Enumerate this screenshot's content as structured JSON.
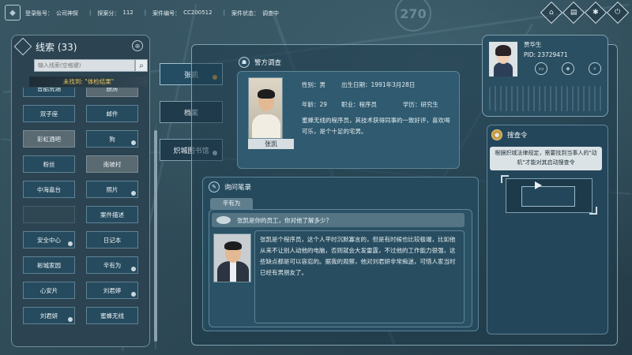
{
  "topbar": {
    "items": [
      {
        "label": "登录账号：",
        "value": "公司神探"
      },
      {
        "label": "探案分：",
        "value": "112"
      },
      {
        "label": "案件编号：",
        "value": "CC200512"
      },
      {
        "label": "案件状态：",
        "value": "调查中"
      }
    ],
    "icons": [
      "home-icon",
      "document-icon",
      "settings-icon",
      "power-icon"
    ]
  },
  "map": {
    "number": "270"
  },
  "clues": {
    "title": "线索 (33)",
    "search_placeholder": "输入线索(空格键)",
    "not_found": "未找到: \"体检结果\"",
    "items": [
      {
        "label": "曾酷荒涵",
        "style": "normal"
      },
      {
        "label": "厨房",
        "style": "gray"
      },
      {
        "label": "双子座",
        "style": "normal"
      },
      {
        "label": "邮件",
        "style": "normal"
      },
      {
        "label": "彩虹酒吧",
        "style": "gray"
      },
      {
        "label": "狗",
        "style": "normal",
        "mark": true
      },
      {
        "label": "粉丝",
        "style": "normal"
      },
      {
        "label": "南坡村",
        "style": "gray"
      },
      {
        "label": "中海嘉台",
        "style": "normal"
      },
      {
        "label": "照片",
        "style": "normal",
        "mark": true
      },
      {
        "label": "",
        "style": "empty"
      },
      {
        "label": "案件描述",
        "style": "normal"
      },
      {
        "label": "安全中心",
        "style": "normal",
        "mark": true
      },
      {
        "label": "日记本",
        "style": "normal"
      },
      {
        "label": "彬城家园",
        "style": "normal"
      },
      {
        "label": "辛有为",
        "style": "normal",
        "mark": true
      },
      {
        "label": "心安片",
        "style": "normal"
      },
      {
        "label": "刘君婷",
        "style": "normal",
        "mark": true
      },
      {
        "label": "刘君妍",
        "style": "normal",
        "mark": true
      },
      {
        "label": "蜜蜂无线",
        "style": "normal"
      }
    ]
  },
  "tabs": [
    {
      "label": "张凯",
      "active": true,
      "dot": true
    },
    {
      "label": "档案",
      "active": false
    },
    {
      "label": "炽城图书馆",
      "active": false,
      "mark": true
    }
  ],
  "police": {
    "title": "警方调查",
    "name": "张凯",
    "gender_label": "性别：",
    "gender": "男",
    "dob_label": "出生日期：",
    "dob": "1991年3月28日",
    "age_label": "年龄：",
    "age": "29",
    "job_label": "职业：",
    "job": "程序员",
    "edu_label": "学历：",
    "edu": "研究生",
    "description": "蜜蜂无线的程序员，其技术获得同事的一致好评，喜欢喝可乐，是个十足的宅男。"
  },
  "inquiry": {
    "title": "询问笔录",
    "tab": "辛有为",
    "question": "张凯是你的员工，你对他了解多少？",
    "answer": "张凯是个程序员，这个人平时沉默寡言的，但是有时候也比较极端，比如他从来不让别人动他的电脑，否则就会大发雷霆，不过他的工作能力很强，这些缺点都是可以容忍的。据我的观察，他对刘君妍非常痴迷，可惜人家当时已经有男朋友了。"
  },
  "profile": {
    "name": "贾华生",
    "pid": "PID: 23729471",
    "buttons": [
      "id-card-icon",
      "badge-icon",
      "search-icon"
    ]
  },
  "warrant": {
    "title": "搜查令",
    "note": "根据炽城法律规定，需要找到当事人的\"动机\"才能对其启动搜查令"
  }
}
